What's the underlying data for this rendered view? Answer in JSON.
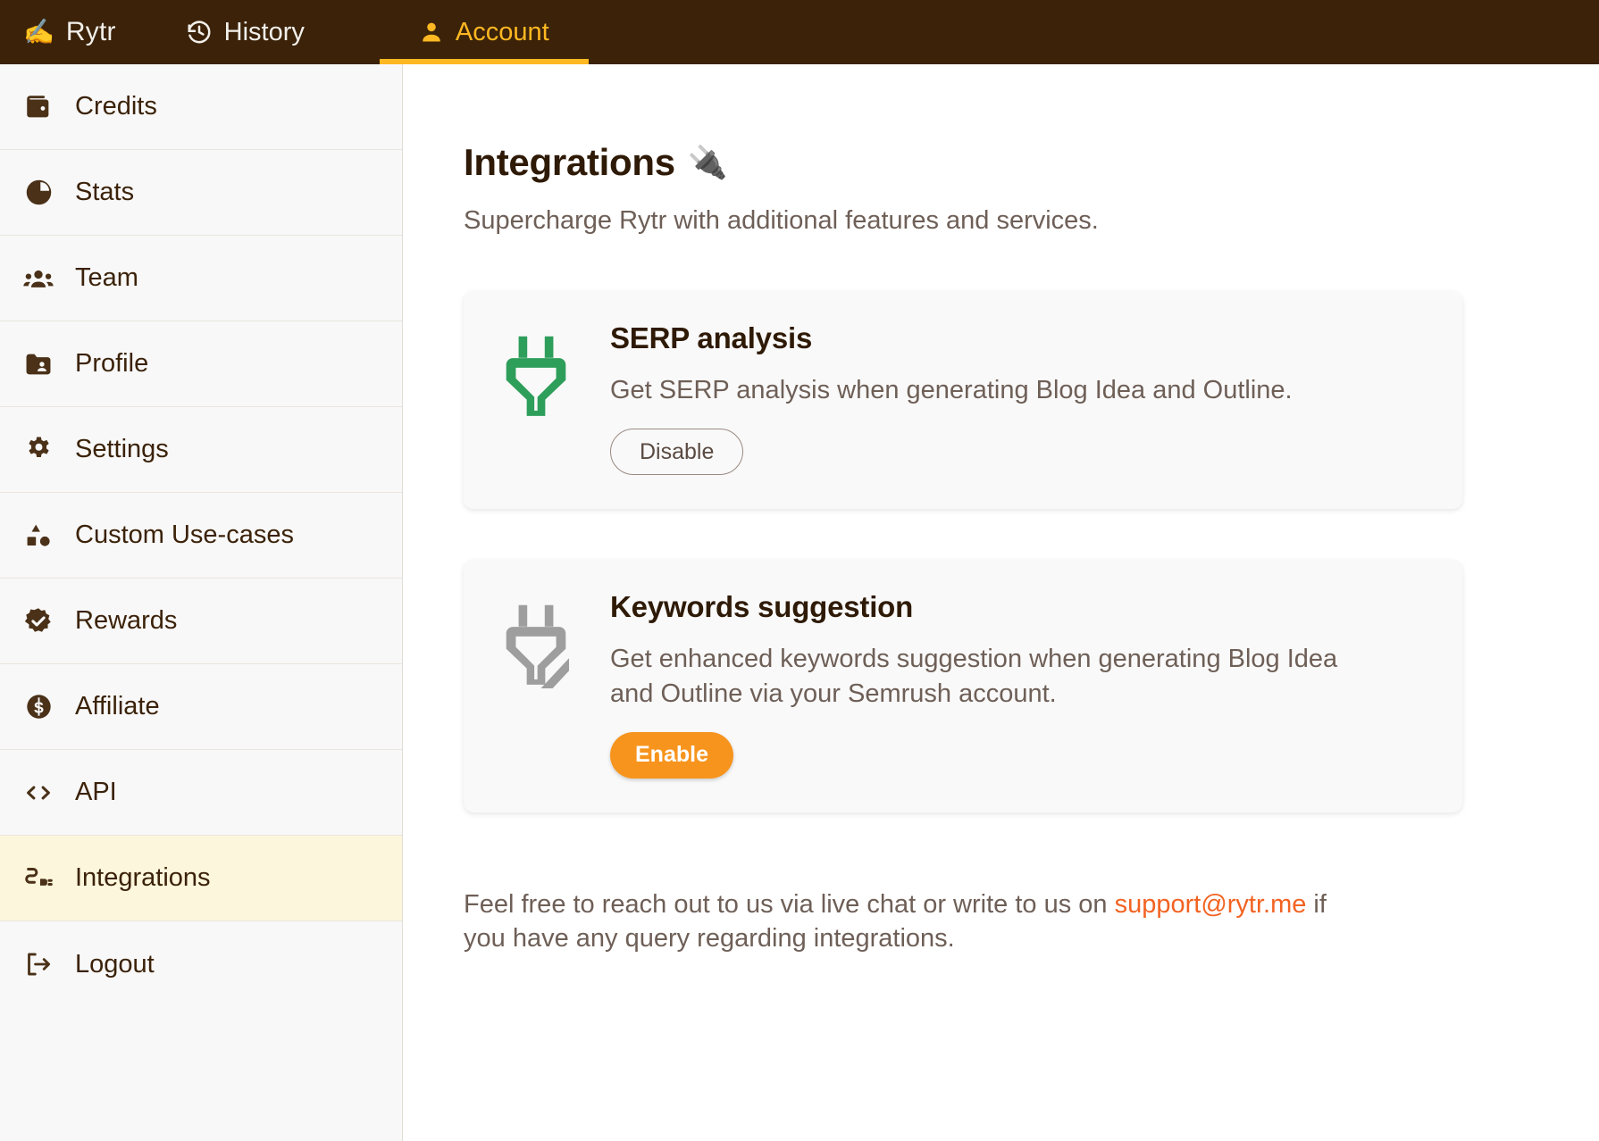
{
  "topbar": {
    "background": "#3B2209",
    "accent": "#FFB822",
    "items": [
      {
        "label": "Rytr",
        "icon": "writing-hand-emoji",
        "glyph": "✍️",
        "active": false
      },
      {
        "label": "History",
        "icon": "history-clock-icon",
        "active": false
      },
      {
        "label": "Account",
        "icon": "person-icon",
        "active": true
      }
    ]
  },
  "sidebar": {
    "active_item": "Integrations",
    "active_background": "#FCF6DC",
    "items": [
      {
        "label": "Credits",
        "icon": "wallet-icon"
      },
      {
        "label": "Stats",
        "icon": "pie-chart-icon"
      },
      {
        "label": "Team",
        "icon": "people-icon"
      },
      {
        "label": "Profile",
        "icon": "folder-person-icon"
      },
      {
        "label": "Settings",
        "icon": "gear-icon"
      },
      {
        "label": "Custom Use-cases",
        "icon": "shapes-icon"
      },
      {
        "label": "Rewards",
        "icon": "verified-badge-icon"
      },
      {
        "label": "Affiliate",
        "icon": "dollar-circle-icon"
      },
      {
        "label": "API",
        "icon": "code-brackets-icon"
      },
      {
        "label": "Integrations",
        "icon": "plug-icon"
      },
      {
        "label": "Logout",
        "icon": "logout-icon"
      }
    ]
  },
  "main": {
    "title": "Integrations",
    "title_emoji": "🔌",
    "subtitle": "Supercharge Rytr with additional features and services.",
    "cards": [
      {
        "title": "SERP analysis",
        "description": "Get SERP analysis when generating Blog Idea and Outline.",
        "icon": "plug-connected-icon",
        "icon_color": "#2E9E5B",
        "button_label": "Disable",
        "button_style": "outline",
        "state": "enabled"
      },
      {
        "title": "Keywords suggestion",
        "description": "Get enhanced keywords suggestion when generating Blog Idea and Outline via your Semrush account.",
        "icon": "plug-disconnected-icon",
        "icon_color": "#9E9E9E",
        "button_label": "Enable",
        "button_style": "primary",
        "button_color": "#F7941D",
        "state": "disabled"
      }
    ],
    "footnote": {
      "before": "Feel free to reach out to us via live chat or write to us on ",
      "link": "support@rytr.me",
      "link_color": "#F26322",
      "after": " if you have any query regarding integrations."
    }
  }
}
